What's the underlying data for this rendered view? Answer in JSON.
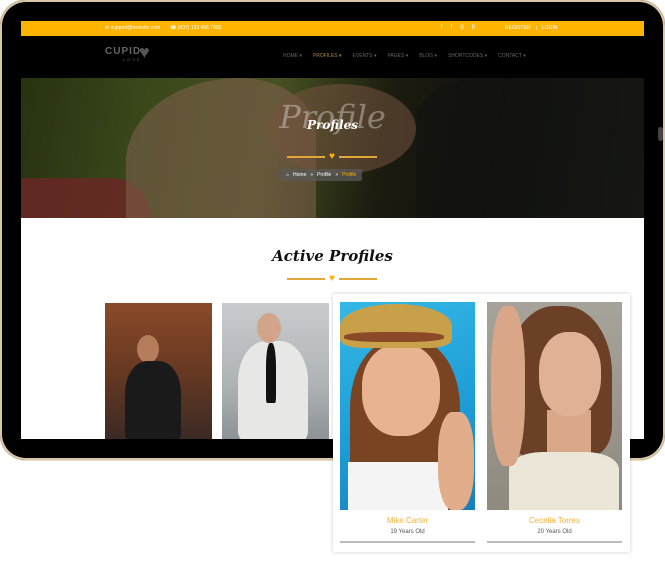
{
  "topbar": {
    "email": "support@website.com",
    "phone": "(007) 123 456 7890",
    "social": [
      "f",
      "t",
      "g",
      "p"
    ],
    "register": "REGISTER",
    "separator": "|",
    "login": "LOGIN"
  },
  "brand": {
    "name": "CUPID",
    "tagline": "LOVE"
  },
  "nav": {
    "items": [
      "HOME ▾",
      "PROFILES ▾",
      "EVENTS ▾",
      "PAGES ▾",
      "BLOG ▾",
      "SHORTCODES ▾",
      "CONTACT ▾"
    ],
    "active_index": 1
  },
  "hero": {
    "watermark": "Profile",
    "title": "Profiles",
    "breadcrumb": {
      "home": "Home",
      "sep1": "»",
      "mid": "Profile",
      "sep2": "»",
      "current": "Profile"
    }
  },
  "section": {
    "title": "Active Profiles"
  },
  "profiles": [
    {
      "name": "Mike Carter",
      "age": "19 Years Old"
    },
    {
      "name": "Cecelia Torres",
      "age": "20 Years Old"
    }
  ],
  "colors": {
    "accent": "#ffb400",
    "topbar": "#ffb400",
    "name": "#f1b23c"
  }
}
